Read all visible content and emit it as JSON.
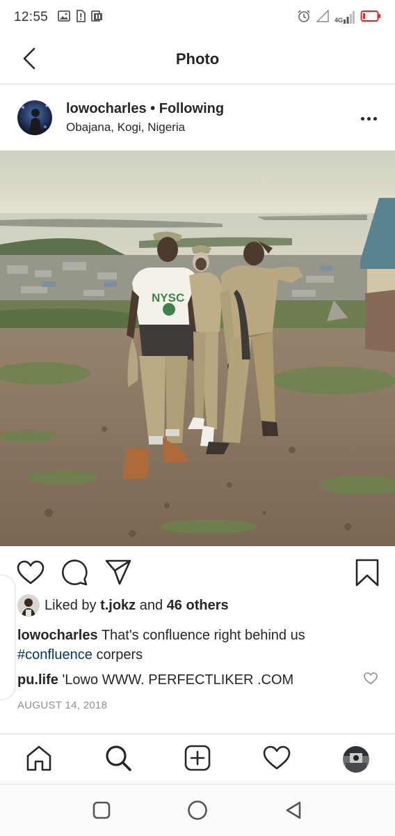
{
  "status_bar": {
    "time": "12:55",
    "network_label": "4G",
    "left_icons": [
      "image-icon",
      "sim-alert-icon",
      "app-notification-icon"
    ],
    "right_icons": [
      "alarm-icon",
      "signal-empty-icon",
      "signal-4g-icon",
      "battery-low-icon"
    ],
    "battery_color": "#e8262d"
  },
  "header": {
    "title": "Photo",
    "back_icon": "back-arrow-icon"
  },
  "post": {
    "username": "lowocharles",
    "separator": "•",
    "follow_status": "Following",
    "location": "Obajana, Kogi, Nigeria",
    "shirt_text": "NYSC",
    "likes": {
      "prefix": "Liked by",
      "user": "t.jokz",
      "conjunction": "and",
      "others": "46 others"
    },
    "caption": {
      "username": "lowocharles",
      "text": "That's confluence right behind us",
      "hashtag": "#confluence",
      "after_hashtag": "corpers"
    },
    "comment": {
      "username": "pu.life",
      "text": "'Lowo WWW. PERFECTLIKER .COM"
    },
    "date": "AUGUST 14, 2018"
  },
  "actions": [
    "heart-icon",
    "comment-icon",
    "share-icon",
    "bookmark-icon"
  ],
  "bottom_nav": [
    "home-icon",
    "search-icon",
    "new-post-icon",
    "activity-icon",
    "profile-avatar"
  ],
  "system_nav": [
    "recents-icon",
    "home-circle-icon",
    "back-triangle-icon"
  ],
  "colors": {
    "text": "#262626",
    "secondary": "#8e8e8e",
    "hashtag": "#00376b",
    "divider": "#dbdbdb"
  }
}
